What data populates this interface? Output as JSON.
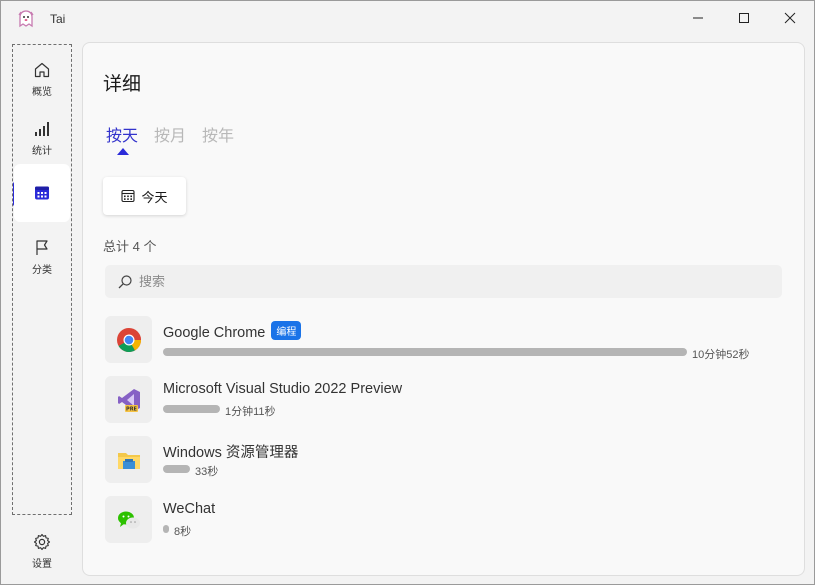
{
  "window": {
    "title": "Tai"
  },
  "sidebar": {
    "items": [
      {
        "label": "概览",
        "icon": "home-icon"
      },
      {
        "label": "统计",
        "icon": "signal-bars-icon"
      },
      {
        "label": "",
        "icon": "calendar-icon",
        "active": true
      },
      {
        "label": "分类",
        "icon": "flag-icon"
      }
    ],
    "settings_label": "设置"
  },
  "main": {
    "title": "详细",
    "tabs": [
      {
        "label": "按天",
        "active": true
      },
      {
        "label": "按月",
        "active": false
      },
      {
        "label": "按年",
        "active": false
      }
    ],
    "date_button": "今天",
    "total": "总计 4 个",
    "search": {
      "placeholder": "搜索"
    },
    "apps": [
      {
        "name": "Google Chrome",
        "badge": "编程",
        "duration": "10分钟52秒",
        "fraction": 1.0,
        "icon": "chrome-icon"
      },
      {
        "name": "Microsoft Visual Studio 2022 Preview",
        "badge": "",
        "duration": "1分钟11秒",
        "fraction": 0.109,
        "icon": "visual-studio-preview-icon"
      },
      {
        "name": "Windows 资源管理器",
        "badge": "",
        "duration": "33秒",
        "fraction": 0.051,
        "icon": "file-explorer-icon"
      },
      {
        "name": "WeChat",
        "badge": "",
        "duration": "8秒",
        "fraction": 0.012,
        "icon": "wechat-icon"
      }
    ]
  },
  "colors": {
    "accent": "#2b2bd9",
    "badge": "#1a73e8",
    "bar": "#b5b5b5"
  }
}
